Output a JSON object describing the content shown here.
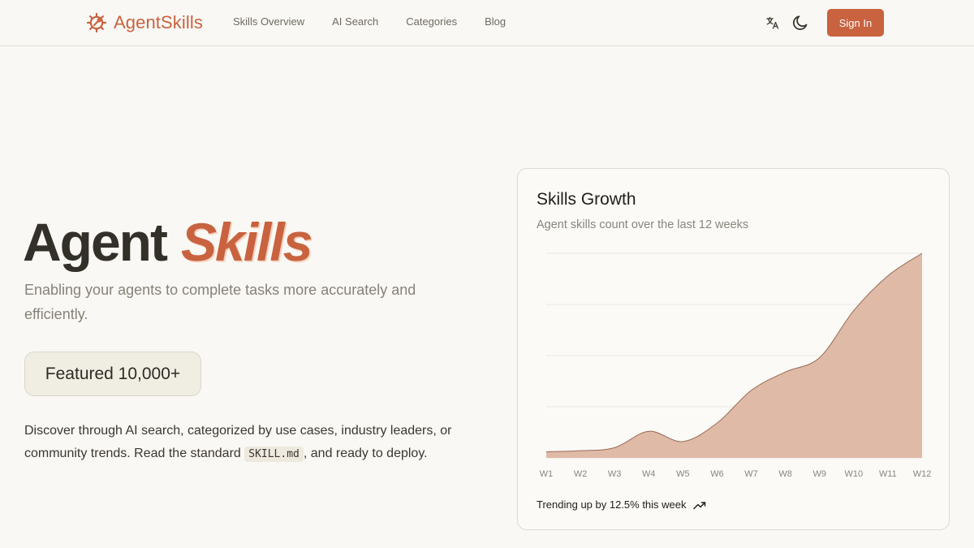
{
  "brand": {
    "name": "AgentSkills",
    "icon": "gear-wrench-icon",
    "accent": "#c8623f"
  },
  "nav": {
    "items": [
      "Skills Overview",
      "AI Search",
      "Categories",
      "Blog"
    ]
  },
  "header_actions": {
    "translate_icon": "translate-icon",
    "theme_icon": "moon-icon",
    "signin_label": "Sign In"
  },
  "hero": {
    "title_plain": "Agent",
    "title_accent": "Skills",
    "subtitle": "Enabling your agents to complete tasks more accurately and efficiently.",
    "featured_badge": "Featured 10,000+",
    "desc_before": "Discover through AI search, categorized by use cases, industry leaders, or community trends. Read the standard ",
    "desc_code": "SKILL.md",
    "desc_after": ", and ready to deploy."
  },
  "card": {
    "title": "Skills Growth",
    "subtitle": "Agent skills count over the last 12 weeks",
    "trend_text": "Trending up by 12.5% this week",
    "trend_icon": "trending-up-icon"
  },
  "chart_data": {
    "type": "area",
    "title": "Skills Growth",
    "subtitle": "Agent skills count over the last 12 weeks",
    "categories": [
      "W1",
      "W2",
      "W3",
      "W4",
      "W5",
      "W6",
      "W7",
      "W8",
      "W9",
      "W10",
      "W11",
      "W12"
    ],
    "values": [
      3,
      3.5,
      5,
      13,
      8,
      17,
      33,
      42,
      49,
      72,
      89,
      100
    ],
    "ylim": [
      0,
      100
    ],
    "grid": true,
    "fill_color": "#dcb6a2",
    "line_color": "#9a6a55"
  }
}
